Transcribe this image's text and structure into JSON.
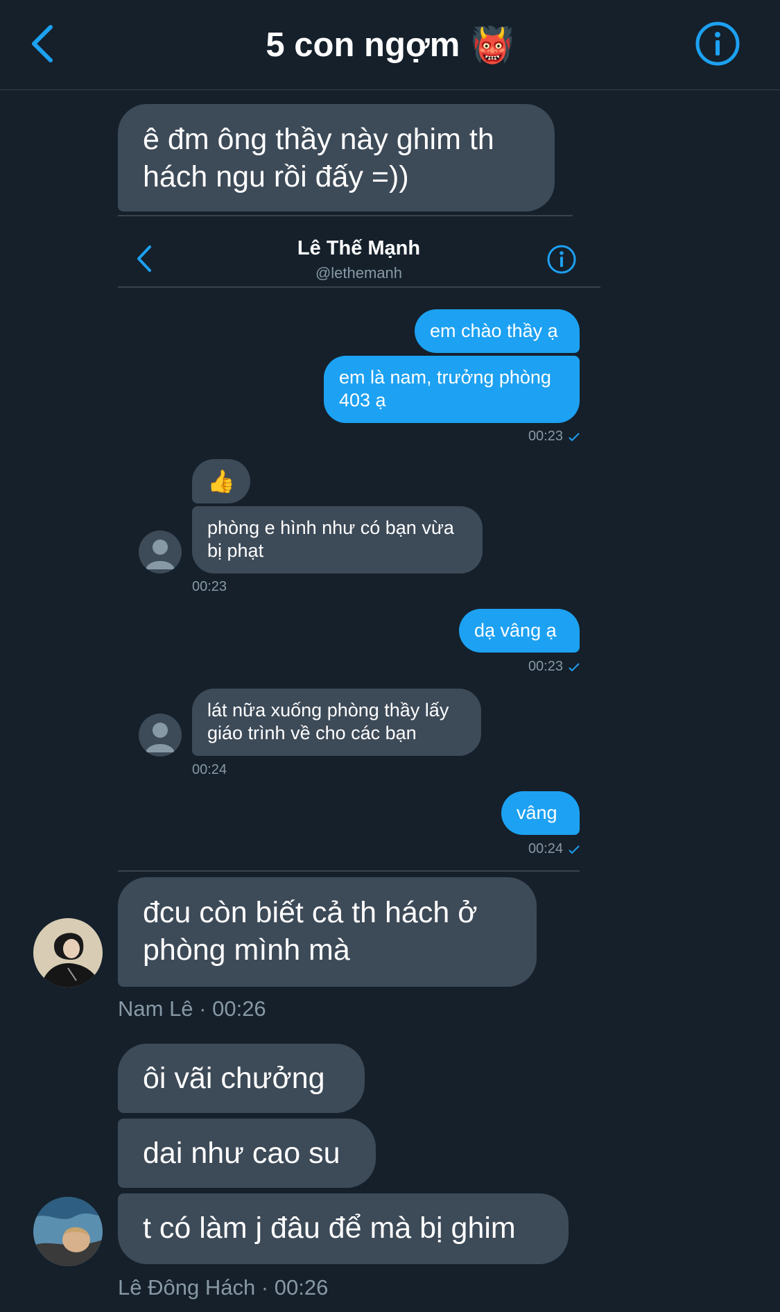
{
  "header": {
    "title": "5 con ngợm",
    "title_emoji": "👹"
  },
  "messages": {
    "m1": "ê đm ông thầy này ghim th hách ngu rồi đấy =))",
    "m2": "đcu còn biết cả th hách ở phòng mình mà",
    "m2_meta": "Nam Lê · 00:26",
    "m3": "ôi vãi chưởng",
    "m4": "dai như cao su",
    "m5": "t có làm j đâu để mà bị ghim",
    "m5_meta": "Lê Đông Hách · 00:26"
  },
  "embedded": {
    "name": "Lê Thế Mạnh",
    "handle": "@lethemanh",
    "s1": "em chào thầy ạ",
    "s2": "em là nam, trưởng phòng 403 ạ",
    "t1": "00:23",
    "r_emoji": "👍",
    "r1": "phòng e hình như có bạn vừa bị phạt",
    "t2": "00:23",
    "s3": "dạ vâng ạ",
    "t3": "00:23",
    "r2": "lát nữa xuống phòng thầy lấy giáo trình về cho các bạn",
    "t4": "00:24",
    "s4": "vâng",
    "t5": "00:24"
  },
  "colors": {
    "background": "#15202b",
    "bubble": "#3d4a58",
    "accent": "#1da1f2",
    "muted": "#8899a6",
    "divider": "#38444d"
  },
  "icons": {
    "back": "chevron-left-icon",
    "info": "info-circle-icon",
    "check": "check-icon",
    "avatar": "default-avatar-icon"
  }
}
